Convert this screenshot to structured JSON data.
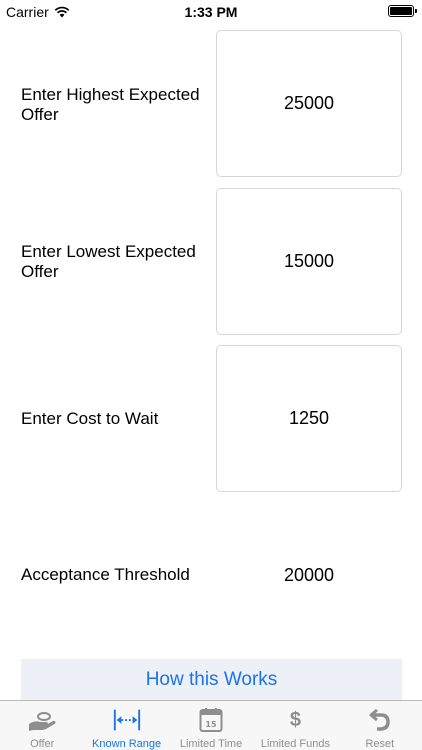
{
  "status_bar": {
    "carrier": "Carrier",
    "time": "1:33 PM"
  },
  "form": {
    "highest": {
      "label": "Enter Highest Expected Offer",
      "value": "25000"
    },
    "lowest": {
      "label": "Enter Lowest Expected Offer",
      "value": "15000"
    },
    "cost": {
      "label": "Enter Cost to Wait",
      "value": "1250"
    },
    "threshold": {
      "label": "Acceptance Threshold",
      "value": "20000"
    }
  },
  "how_button": {
    "label": "How this Works"
  },
  "tabs": [
    {
      "label": "Offer",
      "icon": "hand-offer-icon"
    },
    {
      "label": "Known Range",
      "icon": "range-arrows-icon"
    },
    {
      "label": "Limited Time",
      "icon": "calendar-icon",
      "icon_text": "15"
    },
    {
      "label": "Limited Funds",
      "icon": "dollar-icon",
      "icon_text": "$"
    },
    {
      "label": "Reset",
      "icon": "reset-arrow-icon"
    }
  ],
  "colors": {
    "accent": "#1a73e8",
    "inactive": "#8e8e8e",
    "button_bg": "#eef0f7"
  }
}
